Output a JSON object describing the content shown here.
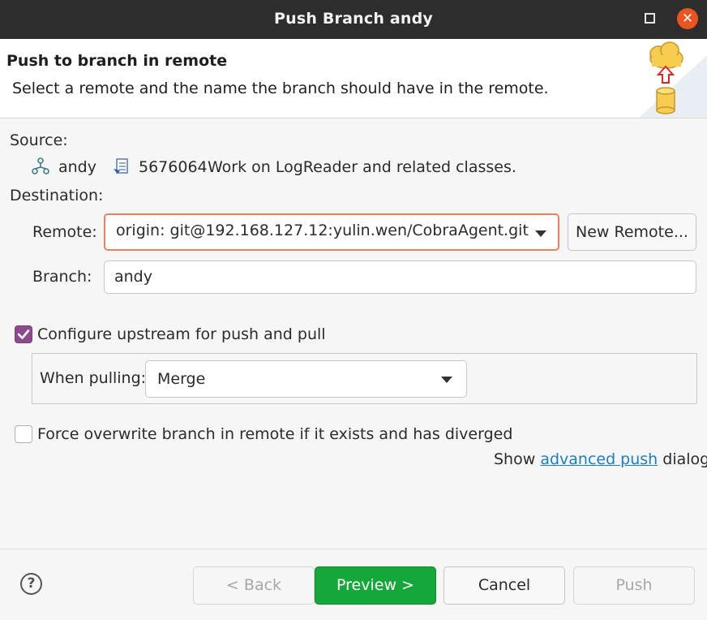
{
  "window": {
    "title": "Push Branch andy",
    "close_glyph": "✕"
  },
  "banner": {
    "title": "Push to branch in remote",
    "description": "Select a remote and the name the branch should have in the remote.",
    "graphic_icon": "push-to-remote-graphic"
  },
  "source": {
    "label": "Source:",
    "branch_icon": "branch-icon",
    "branch": "andy",
    "commit_icon": "commit-icon",
    "commit_id": "5676064",
    "commit_message": "Work on LogReader and related classes."
  },
  "destination": {
    "label": "Destination:",
    "remote_label": "Remote:",
    "remote_value": "origin: git@192.168.127.12:yulin.wen/CobraAgent.git",
    "new_remote_button": "New Remote...",
    "branch_label": "Branch:",
    "branch_value": "andy"
  },
  "upstream": {
    "checked": true,
    "label": "Configure upstream for push and pull",
    "when_pulling_label": "When pulling:",
    "when_pulling_value": "Merge"
  },
  "force": {
    "checked": false,
    "label": "Force overwrite branch in remote if it exists and has diverged"
  },
  "advanced": {
    "prefix": "Show ",
    "link": "advanced push",
    "suffix": " dialog"
  },
  "footer": {
    "help_glyph": "?",
    "back": "< Back",
    "preview": "Preview >",
    "cancel": "Cancel",
    "push": "Push"
  },
  "colors": {
    "accent_checkbox": "#8d4a8e",
    "primary_button": "#16a73a",
    "focus_border": "#e8825a",
    "link": "#1a7ec8",
    "close_button": "#e95420"
  }
}
